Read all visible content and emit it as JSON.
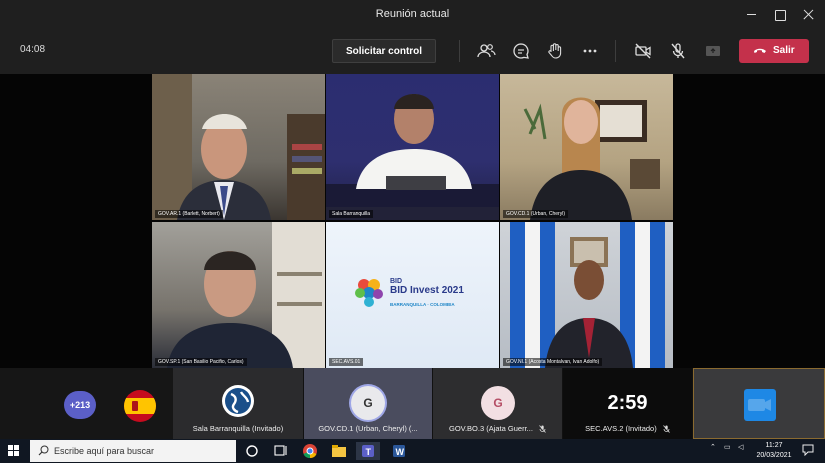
{
  "window": {
    "title": "Reunión actual"
  },
  "meeting": {
    "elapsed": "04:08",
    "request_control_label": "Solicitar control",
    "leave_label": "Salir"
  },
  "video_tiles": [
    {
      "label": "GOV.AR.1 (Barlett, Norbert)"
    },
    {
      "label": "Sala Barranquilla"
    },
    {
      "label": "GOV.CD.1 (Urban, Cheryl)"
    },
    {
      "label": "GOV.SP.1 (San Basilio Pacifio, Carlos)"
    },
    {
      "label": "SEC.AVS.01",
      "logo": {
        "line1": "BID",
        "line2": "BID Invest",
        "year": "2021",
        "place": "BARRANQUILLA · COLOMBIA"
      }
    },
    {
      "label": "GOV.NI.1 (Acosta Montalvan, Ivan Adolfo)"
    }
  ],
  "participants_strip": {
    "more_count": "+213",
    "tiles": [
      {
        "label": "Sala Barranquilla (Invitado)"
      },
      {
        "label": "GOV.CD.1 (Urban, Cheryl) (...",
        "initial": "G"
      },
      {
        "label": "GOV.BO.3 (Ajata Guerr...",
        "initial": "G"
      },
      {
        "label": "SEC.AVS.2 (Invitado)",
        "countdown": "2:59"
      }
    ]
  },
  "taskbar": {
    "search_placeholder": "Escribe aquí para buscar",
    "time": "11:27",
    "date": "20/03/2021"
  },
  "colors": {
    "leave": "#c4314b",
    "accent": "#5b5fc7"
  }
}
